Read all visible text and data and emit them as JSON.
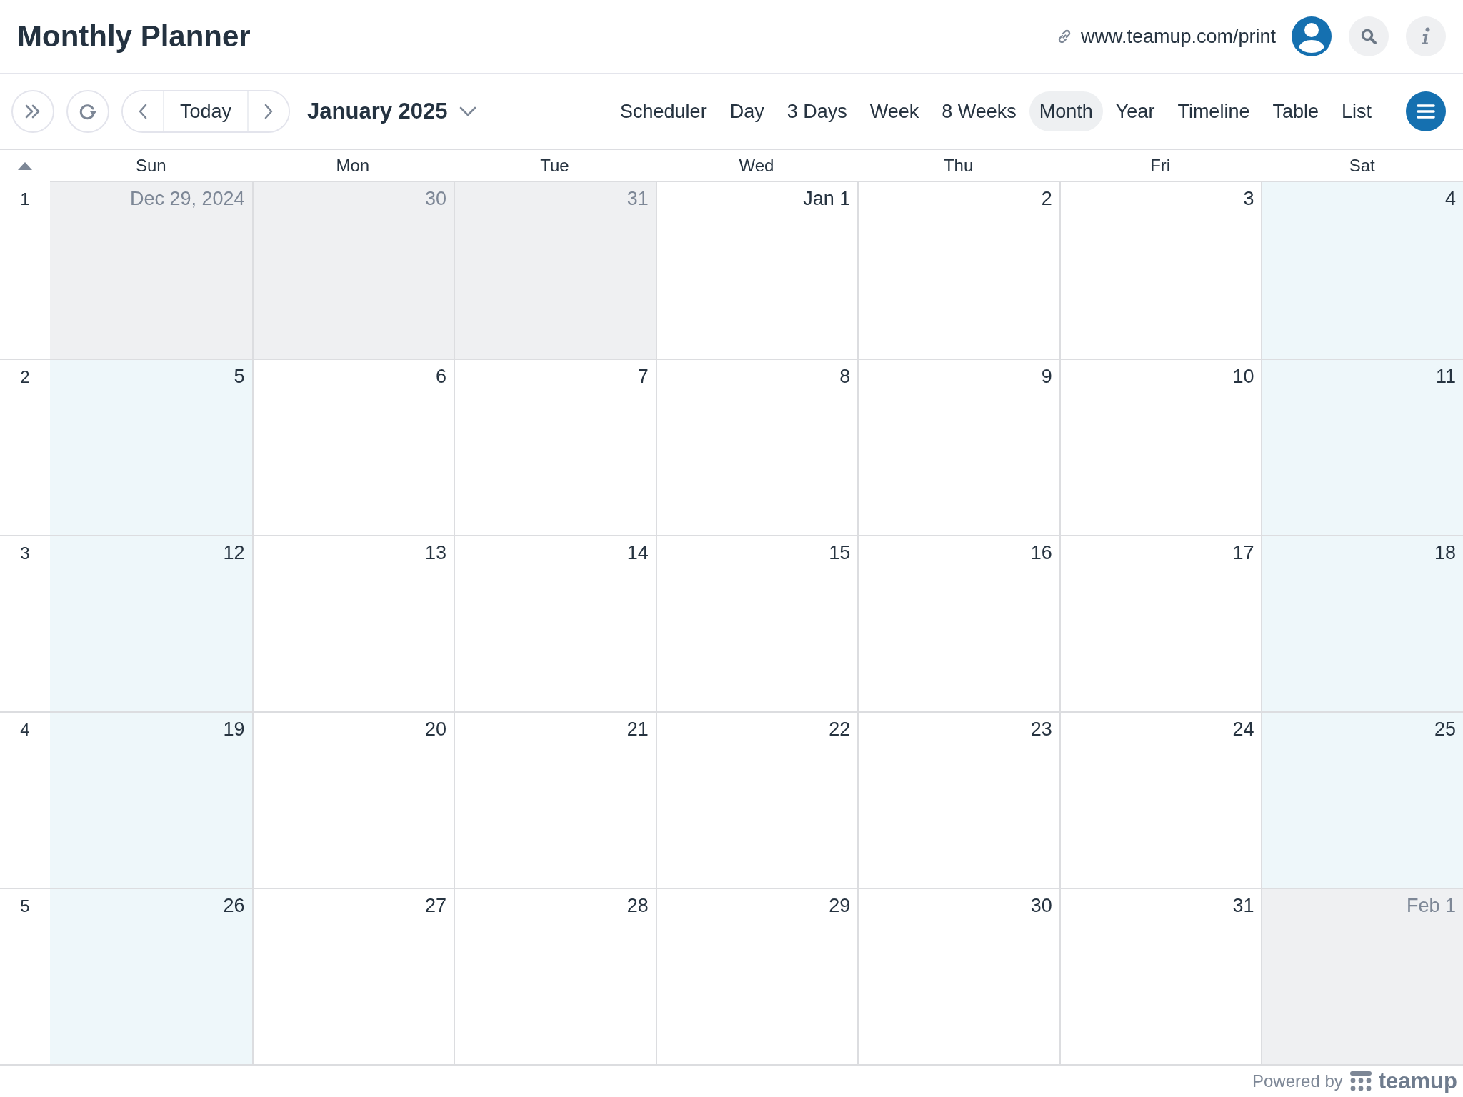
{
  "header": {
    "title": "Monthly Planner",
    "link": "www.teamup.com/print"
  },
  "toolbar": {
    "today_label": "Today",
    "period": "January 2025",
    "views": [
      {
        "label": "Scheduler",
        "selected": false
      },
      {
        "label": "Day",
        "selected": false
      },
      {
        "label": "3 Days",
        "selected": false
      },
      {
        "label": "Week",
        "selected": false
      },
      {
        "label": "8 Weeks",
        "selected": false
      },
      {
        "label": "Month",
        "selected": true
      },
      {
        "label": "Year",
        "selected": false
      },
      {
        "label": "Timeline",
        "selected": false
      },
      {
        "label": "Table",
        "selected": false
      },
      {
        "label": "List",
        "selected": false
      }
    ]
  },
  "calendar": {
    "weekdays": [
      "Sun",
      "Mon",
      "Tue",
      "Wed",
      "Thu",
      "Fri",
      "Sat"
    ],
    "weeks": [
      {
        "number": "1",
        "days": [
          {
            "date": "Dec 29, 2024",
            "kind": "outside"
          },
          {
            "date": "30",
            "kind": "outside"
          },
          {
            "date": "31",
            "kind": "outside"
          },
          {
            "date": "Jan 1",
            "kind": "weekday"
          },
          {
            "date": "2",
            "kind": "weekday"
          },
          {
            "date": "3",
            "kind": "weekday"
          },
          {
            "date": "4",
            "kind": "weekend"
          }
        ]
      },
      {
        "number": "2",
        "days": [
          {
            "date": "5",
            "kind": "weekend"
          },
          {
            "date": "6",
            "kind": "weekday"
          },
          {
            "date": "7",
            "kind": "weekday"
          },
          {
            "date": "8",
            "kind": "weekday"
          },
          {
            "date": "9",
            "kind": "weekday"
          },
          {
            "date": "10",
            "kind": "weekday"
          },
          {
            "date": "11",
            "kind": "weekend"
          }
        ]
      },
      {
        "number": "3",
        "days": [
          {
            "date": "12",
            "kind": "weekend"
          },
          {
            "date": "13",
            "kind": "weekday"
          },
          {
            "date": "14",
            "kind": "weekday"
          },
          {
            "date": "15",
            "kind": "weekday"
          },
          {
            "date": "16",
            "kind": "weekday"
          },
          {
            "date": "17",
            "kind": "weekday"
          },
          {
            "date": "18",
            "kind": "weekend"
          }
        ]
      },
      {
        "number": "4",
        "days": [
          {
            "date": "19",
            "kind": "weekend"
          },
          {
            "date": "20",
            "kind": "weekday"
          },
          {
            "date": "21",
            "kind": "weekday"
          },
          {
            "date": "22",
            "kind": "weekday"
          },
          {
            "date": "23",
            "kind": "weekday"
          },
          {
            "date": "24",
            "kind": "weekday"
          },
          {
            "date": "25",
            "kind": "weekend"
          }
        ]
      },
      {
        "number": "5",
        "days": [
          {
            "date": "26",
            "kind": "weekend"
          },
          {
            "date": "27",
            "kind": "weekday"
          },
          {
            "date": "28",
            "kind": "weekday"
          },
          {
            "date": "29",
            "kind": "weekday"
          },
          {
            "date": "30",
            "kind": "weekday"
          },
          {
            "date": "31",
            "kind": "weekday"
          },
          {
            "date": "Feb 1",
            "kind": "outside"
          }
        ]
      }
    ]
  },
  "footer": {
    "powered_by": "Powered by",
    "brand": "teamup"
  }
}
